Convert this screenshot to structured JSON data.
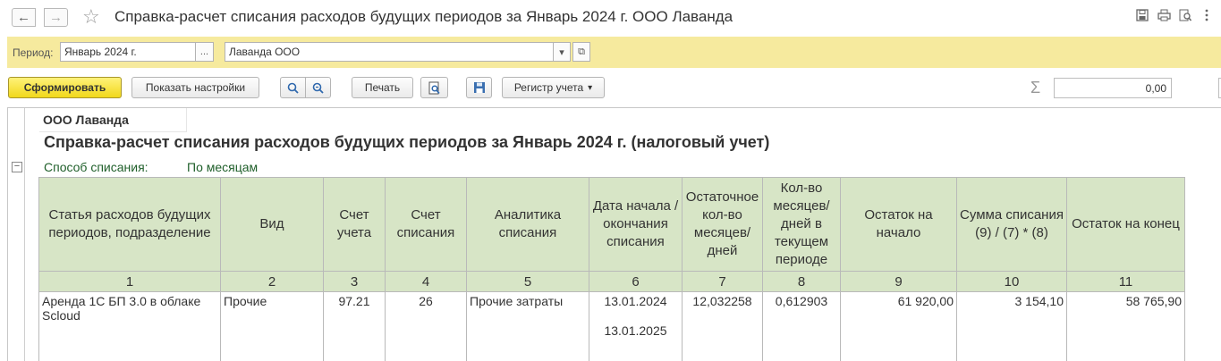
{
  "window": {
    "title": "Справка-расчет списания расходов будущих периодов за Январь 2024 г. ООО Лаванда",
    "back_glyph": "←",
    "forward_glyph": "→",
    "star_glyph": "☆"
  },
  "params": {
    "period_label": "Период:",
    "period_value": "Январь 2024 г.",
    "period_select_btn": "...",
    "organization_value": "Лаванда ООО",
    "dropdown_glyph": "▾",
    "open_glyph": "⧉"
  },
  "toolbar": {
    "generate": "Сформировать",
    "show_settings": "Показать настройки",
    "find_glyph": "🔍",
    "find_next_glyph": "⟳",
    "print": "Печать",
    "preview_glyph": "🔎",
    "save_glyph": "💾",
    "register": "Регистр учета",
    "register_dropdown": "▾",
    "sigma": "Σ",
    "sum_value": "0,00"
  },
  "report": {
    "organization": "ООО Лаванда",
    "heading": "Справка-расчет списания расходов будущих периодов за Январь 2024 г. (налоговый учет)",
    "method_label": "Способ списания:",
    "method_value": "По месяцам",
    "collapse_glyph": "−",
    "columns": [
      "Статья расходов будущих периодов, подразделение",
      "Вид",
      "Счет учета",
      "Счет списания",
      "Аналитика списания",
      "Дата начала / окончания списания",
      "Остаточное кол-во месяцев/ дней",
      "Кол-во месяцев/ дней в текущем периоде",
      "Остаток на начало",
      "Сумма списания (9) / (7) * (8)",
      "Остаток на конец"
    ],
    "column_numbers": [
      "1",
      "2",
      "3",
      "4",
      "5",
      "6",
      "7",
      "8",
      "9",
      "10",
      "11"
    ],
    "rows": [
      {
        "item": "Аренда 1С БП 3.0 в облаке Scloud",
        "type": "Прочие",
        "account": "97.21",
        "writeoff_account": "26",
        "analytics": "Прочие затраты",
        "date_start": "13.01.2024",
        "date_end": "13.01.2025",
        "remaining": "12,032258",
        "current_period": "0,612903",
        "balance_start": "61 920,00",
        "writeoff_sum": "3 154,10",
        "balance_end": "58 765,90"
      }
    ]
  }
}
